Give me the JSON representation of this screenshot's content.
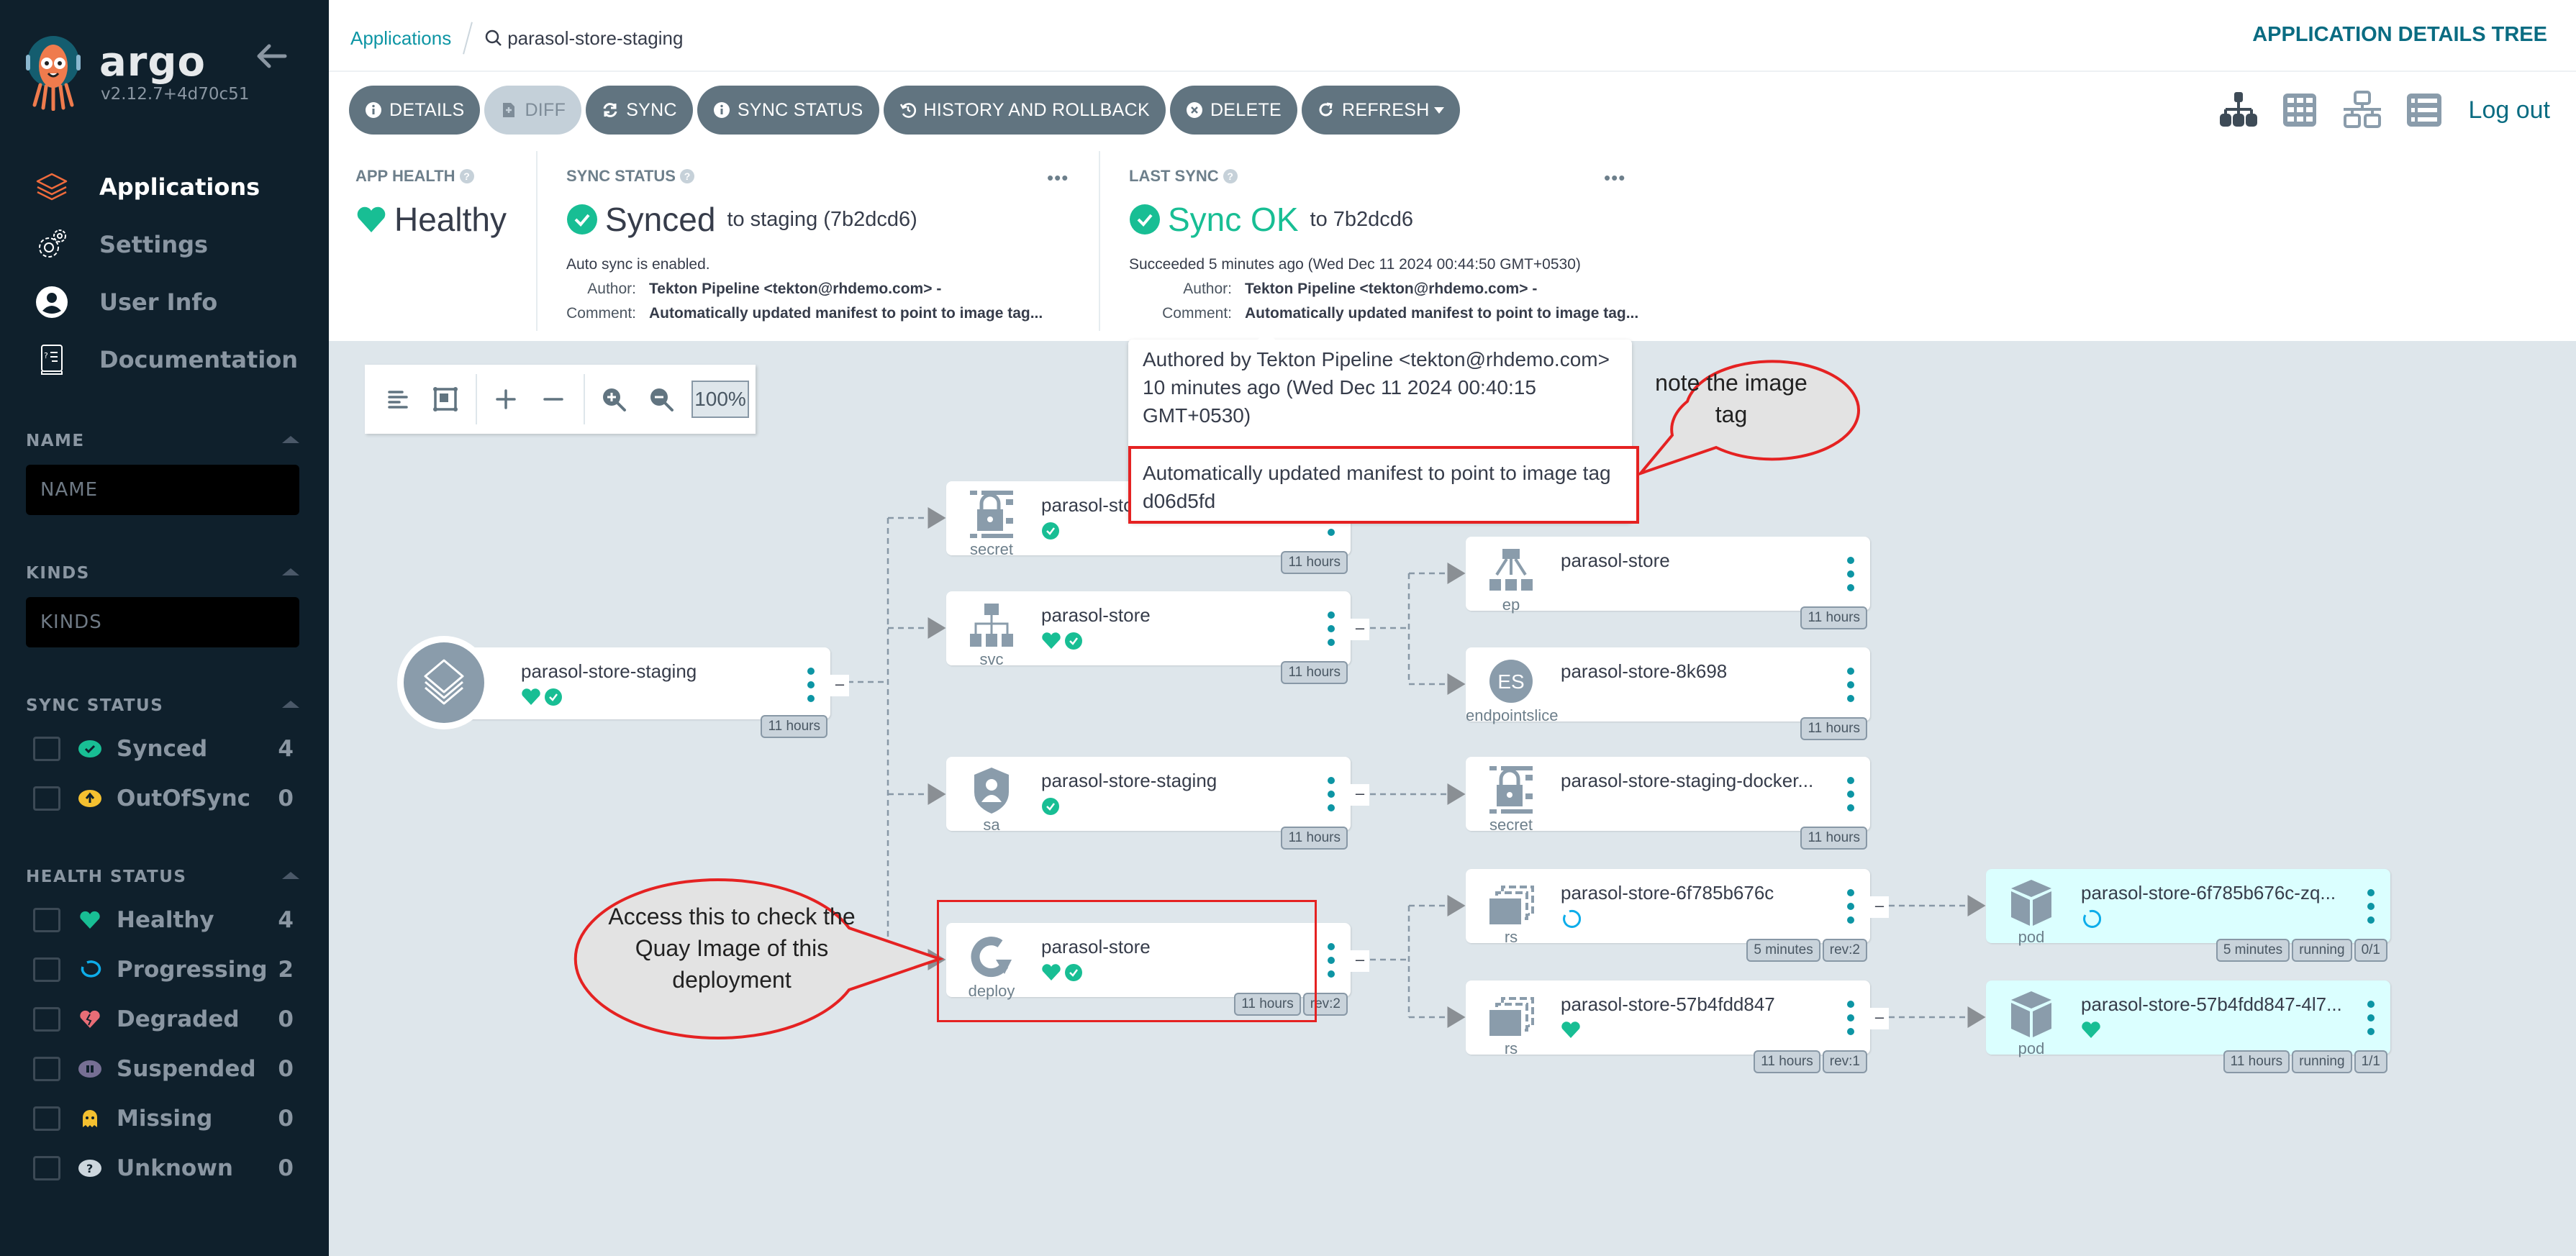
{
  "sidebar": {
    "brand": "argo",
    "version": "v2.12.7+4d70c51",
    "nav": [
      {
        "label": "Applications",
        "icon": "layers-icon",
        "active": true
      },
      {
        "label": "Settings",
        "icon": "gears-icon",
        "active": false
      },
      {
        "label": "User Info",
        "icon": "user-circle-icon",
        "active": false
      },
      {
        "label": "Documentation",
        "icon": "book-icon",
        "active": false
      }
    ],
    "filters": {
      "name": {
        "title": "NAME",
        "placeholder": "NAME",
        "value": ""
      },
      "kinds": {
        "title": "KINDS",
        "placeholder": "KINDS",
        "value": ""
      },
      "sync_status": {
        "title": "SYNC STATUS",
        "items": [
          {
            "label": "Synced",
            "count": "4",
            "icon": "check-circle-icon",
            "color": "#18be94"
          },
          {
            "label": "OutOfSync",
            "count": "0",
            "icon": "arrow-up-circle-icon",
            "color": "#f4c030"
          }
        ]
      },
      "health_status": {
        "title": "HEALTH STATUS",
        "items": [
          {
            "label": "Healthy",
            "count": "4",
            "icon": "heart-icon",
            "color": "#18be94"
          },
          {
            "label": "Progressing",
            "count": "2",
            "icon": "spinner-icon",
            "color": "#0dadea"
          },
          {
            "label": "Degraded",
            "count": "0",
            "icon": "broken-heart-icon",
            "color": "#e96d76"
          },
          {
            "label": "Suspended",
            "count": "0",
            "icon": "pause-circle-icon",
            "color": "#766f94"
          },
          {
            "label": "Missing",
            "count": "0",
            "icon": "ghost-icon",
            "color": "#f4c030"
          },
          {
            "label": "Unknown",
            "count": "0",
            "icon": "question-circle-icon",
            "color": "#ccd6dd"
          }
        ]
      }
    }
  },
  "header": {
    "breadcrumb_root": "Applications",
    "breadcrumb_current": "parasol-store-staging",
    "page_title": "APPLICATION DETAILS TREE",
    "logout": "Log out"
  },
  "toolbar": {
    "buttons": [
      {
        "label": "DETAILS",
        "icon": "info-circle-icon",
        "disabled": false
      },
      {
        "label": "DIFF",
        "icon": "file-diff-icon",
        "disabled": true
      },
      {
        "label": "SYNC",
        "icon": "sync-icon",
        "disabled": false
      },
      {
        "label": "SYNC STATUS",
        "icon": "info-circle-icon",
        "disabled": false
      },
      {
        "label": "HISTORY AND ROLLBACK",
        "icon": "history-icon",
        "disabled": false
      },
      {
        "label": "DELETE",
        "icon": "times-circle-icon",
        "disabled": false
      },
      {
        "label": "REFRESH",
        "icon": "redo-icon",
        "disabled": false,
        "dropdown": true
      }
    ],
    "views": [
      "tree-view-icon",
      "pods-view-icon",
      "network-view-icon",
      "list-view-icon"
    ],
    "active_view": "tree-view-icon"
  },
  "status": {
    "app_health": {
      "title": "APP HEALTH",
      "value": "Healthy",
      "color": "#18be94"
    },
    "sync_status": {
      "title": "SYNC STATUS",
      "value": "Synced",
      "target": "to staging (7b2dcd6)",
      "auto_sync": "Auto sync is enabled.",
      "author_label": "Author:",
      "author": "Tekton Pipeline <tekton@rhdemo.com> -",
      "comment_label": "Comment:",
      "comment": "Automatically updated manifest to point to image tag..."
    },
    "last_sync": {
      "title": "LAST SYNC",
      "value": "Sync OK",
      "target": "to 7b2dcd6",
      "succeeded": "Succeeded 5 minutes ago (Wed Dec 11 2024 00:44:50 GMT+0530)",
      "author_label": "Author:",
      "author": "Tekton Pipeline <tekton@rhdemo.com> -",
      "comment_label": "Comment:",
      "comment": "Automatically updated manifest to point to image tag...",
      "color": "#18be94"
    }
  },
  "tooltip": {
    "authored": "Authored by Tekton Pipeline <tekton@rhdemo.com> 10 minutes ago (Wed Dec 11 2024 00:40:15 GMT+0530)",
    "message": "Automatically updated manifest to point to image tag d06d5fd"
  },
  "annotations": {
    "note_tag": "note the image tag",
    "access_deploy": "Access this to check the Quay Image of this deployment"
  },
  "graph": {
    "zoom_level": "100%",
    "root": {
      "name": "parasol-store-staging",
      "health": "Healthy",
      "sync": "Synced",
      "age": "11 hours"
    },
    "nodes": [
      {
        "id": "secret1",
        "kind": "secret",
        "name": "parasol-sto",
        "health": null,
        "sync": "Synced",
        "tags": [
          "11 hours"
        ],
        "pod": false
      },
      {
        "id": "svc",
        "kind": "svc",
        "name": "parasol-store",
        "health": "Healthy",
        "sync": "Synced",
        "tags": [
          "11 hours"
        ],
        "pod": false,
        "collapsible": true
      },
      {
        "id": "sa",
        "kind": "sa",
        "name": "parasol-store-staging",
        "health": null,
        "sync": "Synced",
        "tags": [
          "11 hours"
        ],
        "pod": false,
        "collapsible": true
      },
      {
        "id": "deploy",
        "kind": "deploy",
        "name": "parasol-store",
        "health": "Healthy",
        "sync": "Synced",
        "tags": [
          "11 hours",
          "rev:2"
        ],
        "pod": false,
        "collapsible": true
      },
      {
        "id": "ep",
        "kind": "ep",
        "name": "parasol-store",
        "health": null,
        "sync": null,
        "tags": [
          "11 hours"
        ],
        "pod": false
      },
      {
        "id": "es",
        "kind": "endpointslice",
        "name": "parasol-store-8k698",
        "health": null,
        "sync": null,
        "tags": [
          "11 hours"
        ],
        "pod": false
      },
      {
        "id": "secret2",
        "kind": "secret",
        "name": "parasol-store-staging-docker...",
        "health": null,
        "sync": null,
        "tags": [
          "11 hours"
        ],
        "pod": false
      },
      {
        "id": "rs1",
        "kind": "rs",
        "name": "parasol-store-6f785b676c",
        "health": "Progressing",
        "sync": null,
        "tags": [
          "5 minutes",
          "rev:2"
        ],
        "pod": false,
        "collapsible": true
      },
      {
        "id": "rs2",
        "kind": "rs",
        "name": "parasol-store-57b4fdd847",
        "health": "Healthy",
        "sync": null,
        "tags": [
          "11 hours",
          "rev:1"
        ],
        "pod": false,
        "collapsible": true
      },
      {
        "id": "pod1",
        "kind": "pod",
        "name": "parasol-store-6f785b676c-zq...",
        "health": "Progressing",
        "sync": null,
        "tags": [
          "5 minutes",
          "running",
          "0/1"
        ],
        "pod": true
      },
      {
        "id": "pod2",
        "kind": "pod",
        "name": "parasol-store-57b4fdd847-4l7...",
        "health": "Healthy",
        "sync": null,
        "tags": [
          "11 hours",
          "running",
          "1/1"
        ],
        "pod": true
      }
    ]
  },
  "colors": {
    "sidebar_bg": "#0f202c",
    "accent_teal": "#0d95a4",
    "healthy": "#18be94",
    "progressing": "#0dadea",
    "button_bg": "#617480",
    "graph_bg": "#dee6eb",
    "annotation_red": "#e52222"
  }
}
